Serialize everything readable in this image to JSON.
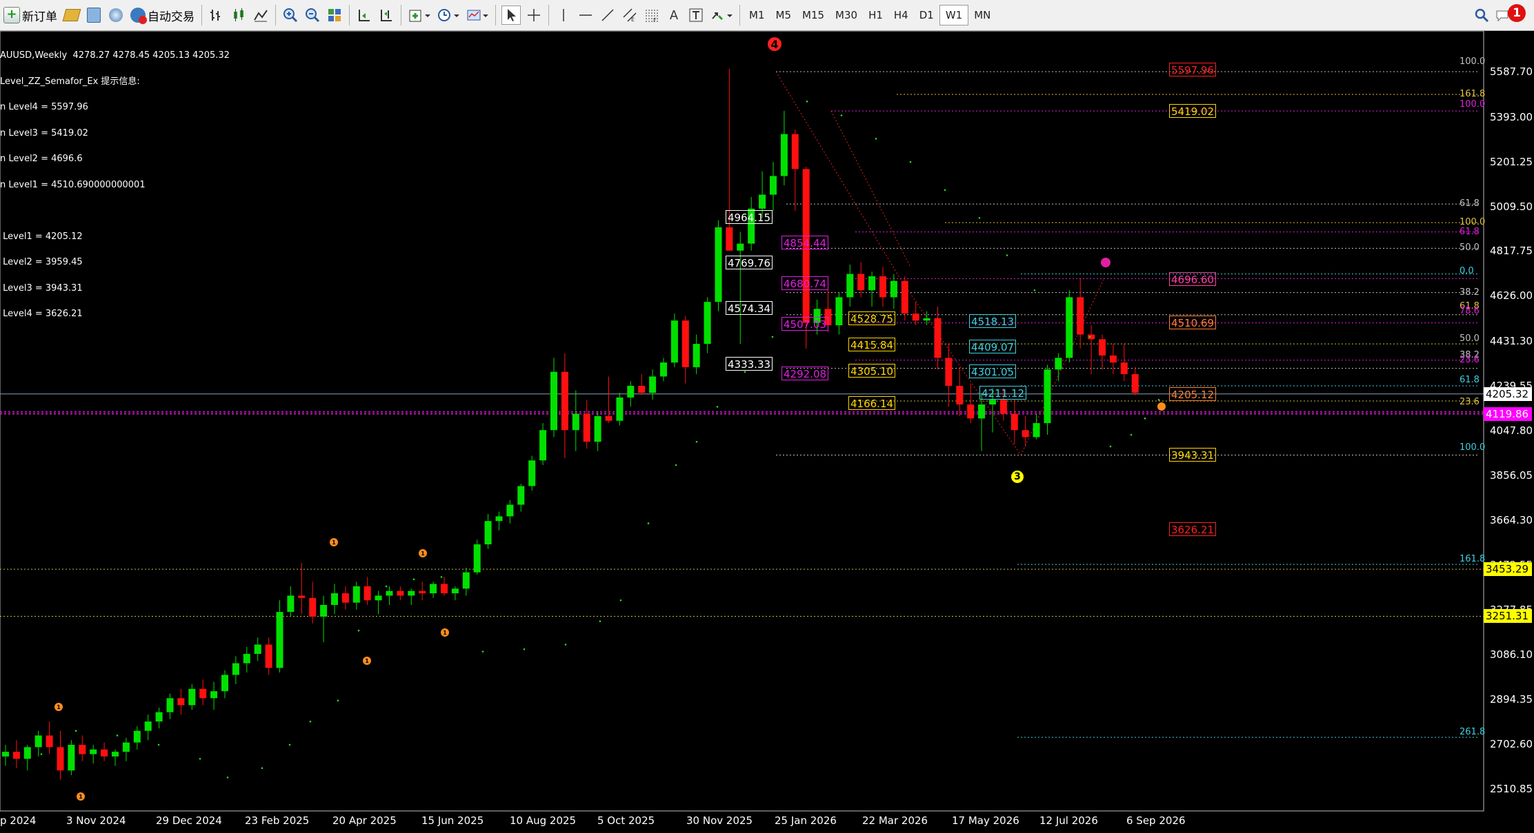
{
  "toolbar": {
    "new_order": "新订单",
    "auto_trade": "自动交易",
    "timeframes": [
      "M1",
      "M5",
      "M15",
      "M30",
      "H1",
      "H4",
      "D1",
      "W1",
      "MN"
    ],
    "active_timeframe": "W1",
    "alerts_count": "1",
    "text_tool": "A"
  },
  "info_panel": {
    "header": "AUUSD,Weekly  4278.27 4278.45 4205.13 4205.32",
    "indicator": "Level_ZZ_Semafor_Ex 提示信息:",
    "lines": [
      "n Level4 = 5597.96",
      "n Level3 = 5419.02",
      "n Level2 = 4696.6",
      "n Level1 = 4510.690000000001",
      "",
      " Level1 = 4205.12",
      " Level2 = 3959.45",
      " Level3 = 3943.31",
      " Level4 = 3626.21"
    ]
  },
  "price_axis": {
    "labels": [
      "5587.70",
      "5393.00",
      "5201.25",
      "5009.50",
      "4817.75",
      "4626.00",
      "4431.30",
      "4239.55",
      "4047.80",
      "3856.05",
      "3664.30",
      "3472.55",
      "3277.85",
      "3086.10",
      "2894.35",
      "2702.60",
      "2510.85"
    ],
    "current_price": "4205.32",
    "tag_magenta": "4119.86",
    "tag_yellow_1": "3453.29",
    "tag_yellow_2": "3251.31"
  },
  "time_axis": {
    "labels": [
      "p 2024",
      "3 Nov 2024",
      "29 Dec 2024",
      "23 Feb 2025",
      "20 Apr 2025",
      "15 Jun 2025",
      "10 Aug 2025",
      "5 Oct 2025",
      "30 Nov 2025",
      "25 Jan 2026",
      "22 Mar 2026",
      "17 May 2026",
      "12 Jul 2026",
      "6 Sep 2026"
    ]
  },
  "price_labels": [
    {
      "text": "5597.96",
      "color": "#ff2020"
    },
    {
      "text": "5419.02",
      "color": "#ffd700"
    },
    {
      "text": "4964.15",
      "color": "#ffffff"
    },
    {
      "text": "4769.76",
      "color": "#ffffff"
    },
    {
      "text": "4574.34",
      "color": "#ffffff"
    },
    {
      "text": "4333.33",
      "color": "#ffffff"
    },
    {
      "text": "4854.44",
      "color": "#e020e0"
    },
    {
      "text": "4680.74",
      "color": "#e020e0"
    },
    {
      "text": "4507.03",
      "color": "#e020e0"
    },
    {
      "text": "4292.08",
      "color": "#e020e0"
    },
    {
      "text": "4528.75",
      "color": "#ffd700"
    },
    {
      "text": "4415.84",
      "color": "#ffd700"
    },
    {
      "text": "4305.10",
      "color": "#ffd700"
    },
    {
      "text": "4166.14",
      "color": "#ffd700"
    },
    {
      "text": "4518.13",
      "color": "#40d0e0"
    },
    {
      "text": "4409.07",
      "color": "#40d0e0"
    },
    {
      "text": "4301.05",
      "color": "#40d0e0"
    },
    {
      "text": "4211.12",
      "color": "#40d0e0"
    },
    {
      "text": "4696.60",
      "color": "#ff40a0"
    },
    {
      "text": "4510.69",
      "color": "#ff8030"
    },
    {
      "text": "4205.12",
      "color": "#ff8030"
    },
    {
      "text": "3943.31",
      "color": "#ffd700"
    },
    {
      "text": "3626.21",
      "color": "#ff2020"
    }
  ],
  "fib_labels": [
    "100.0",
    "161.8",
    "100.0",
    "61.8",
    "100.0",
    "61.8",
    "50.0",
    "0.0",
    "38.2",
    "61.8",
    "78.6",
    "50.0",
    "38.2",
    "23.6",
    "61.8",
    "23.6",
    "100.0",
    "161.8",
    "261.8"
  ],
  "semafor_markers": [
    "4",
    "3",
    "1",
    "1",
    "1",
    "1",
    "1",
    "1"
  ],
  "chart_data": {
    "type": "candlestick",
    "symbol": "AUUSD",
    "timeframe": "Weekly",
    "ohlc_last": {
      "open": 4278.27,
      "high": 4278.45,
      "low": 4205.13,
      "close": 4205.32
    },
    "ylim": [
      2420,
      5720
    ],
    "candles": [
      [
        2650,
        2700,
        2610,
        2670
      ],
      [
        2670,
        2720,
        2600,
        2640
      ],
      [
        2640,
        2700,
        2590,
        2690
      ],
      [
        2690,
        2760,
        2650,
        2740
      ],
      [
        2740,
        2800,
        2660,
        2690
      ],
      [
        2690,
        2760,
        2550,
        2590
      ],
      [
        2590,
        2720,
        2570,
        2700
      ],
      [
        2700,
        2740,
        2630,
        2660
      ],
      [
        2660,
        2700,
        2620,
        2680
      ],
      [
        2680,
        2710,
        2630,
        2650
      ],
      [
        2650,
        2680,
        2610,
        2670
      ],
      [
        2670,
        2730,
        2630,
        2710
      ],
      [
        2710,
        2780,
        2680,
        2760
      ],
      [
        2760,
        2830,
        2720,
        2800
      ],
      [
        2800,
        2860,
        2770,
        2840
      ],
      [
        2840,
        2920,
        2810,
        2900
      ],
      [
        2900,
        2940,
        2830,
        2870
      ],
      [
        2870,
        2960,
        2850,
        2940
      ],
      [
        2940,
        2980,
        2870,
        2900
      ],
      [
        2900,
        2970,
        2850,
        2930
      ],
      [
        2930,
        3020,
        2900,
        3000
      ],
      [
        3000,
        3080,
        2960,
        3050
      ],
      [
        3050,
        3120,
        3010,
        3090
      ],
      [
        3090,
        3160,
        3060,
        3130
      ],
      [
        3130,
        3160,
        3000,
        3030
      ],
      [
        3030,
        3320,
        3010,
        3270
      ],
      [
        3270,
        3380,
        3250,
        3340
      ],
      [
        3340,
        3480,
        3260,
        3330
      ],
      [
        3330,
        3400,
        3220,
        3250
      ],
      [
        3250,
        3340,
        3140,
        3300
      ],
      [
        3300,
        3390,
        3260,
        3350
      ],
      [
        3350,
        3380,
        3280,
        3310
      ],
      [
        3310,
        3400,
        3280,
        3380
      ],
      [
        3380,
        3420,
        3300,
        3320
      ],
      [
        3320,
        3360,
        3260,
        3340
      ],
      [
        3340,
        3380,
        3300,
        3360
      ],
      [
        3360,
        3380,
        3320,
        3340
      ],
      [
        3340,
        3370,
        3300,
        3360
      ],
      [
        3360,
        3400,
        3320,
        3350
      ],
      [
        3350,
        3400,
        3330,
        3390
      ],
      [
        3390,
        3420,
        3340,
        3350
      ],
      [
        3350,
        3380,
        3320,
        3370
      ],
      [
        3370,
        3460,
        3340,
        3440
      ],
      [
        3440,
        3580,
        3430,
        3560
      ],
      [
        3560,
        3690,
        3540,
        3660
      ],
      [
        3660,
        3700,
        3620,
        3680
      ],
      [
        3680,
        3750,
        3650,
        3730
      ],
      [
        3730,
        3820,
        3700,
        3810
      ],
      [
        3810,
        3940,
        3790,
        3920
      ],
      [
        3920,
        4080,
        3900,
        4050
      ],
      [
        4050,
        4360,
        4020,
        4300
      ],
      [
        4300,
        4380,
        3930,
        4050
      ],
      [
        4050,
        4220,
        3960,
        4120
      ],
      [
        4120,
        4180,
        3970,
        4000
      ],
      [
        4000,
        4130,
        3960,
        4110
      ],
      [
        4110,
        4280,
        4080,
        4090
      ],
      [
        4090,
        4210,
        4070,
        4190
      ],
      [
        4190,
        4260,
        4150,
        4240
      ],
      [
        4240,
        4290,
        4200,
        4210
      ],
      [
        4210,
        4310,
        4180,
        4280
      ],
      [
        4280,
        4360,
        4260,
        4340
      ],
      [
        4340,
        4550,
        4320,
        4520
      ],
      [
        4520,
        4540,
        4250,
        4320
      ],
      [
        4320,
        4460,
        4290,
        4420
      ],
      [
        4420,
        4620,
        4380,
        4600
      ],
      [
        4600,
        4950,
        4560,
        4920
      ],
      [
        4920,
        5600,
        4900,
        4820
      ],
      [
        4820,
        4900,
        4420,
        4850
      ],
      [
        4850,
        5050,
        4820,
        5000
      ],
      [
        5000,
        5160,
        4960,
        5060
      ],
      [
        5060,
        5200,
        4990,
        5140
      ],
      [
        5140,
        5420,
        5100,
        5320
      ],
      [
        5320,
        5340,
        4990,
        5170
      ],
      [
        5170,
        5180,
        4400,
        4510
      ],
      [
        4510,
        4610,
        4460,
        4570
      ],
      [
        4570,
        4680,
        4470,
        4500
      ],
      [
        4500,
        4640,
        4460,
        4620
      ],
      [
        4620,
        4760,
        4580,
        4720
      ],
      [
        4720,
        4770,
        4620,
        4650
      ],
      [
        4650,
        4730,
        4580,
        4710
      ],
      [
        4710,
        4750,
        4580,
        4620
      ],
      [
        4620,
        4720,
        4570,
        4690
      ],
      [
        4690,
        4710,
        4520,
        4550
      ],
      [
        4550,
        4600,
        4500,
        4520
      ],
      [
        4520,
        4560,
        4500,
        4530
      ],
      [
        4530,
        4580,
        4310,
        4360
      ],
      [
        4360,
        4420,
        4150,
        4240
      ],
      [
        4240,
        4320,
        4110,
        4160
      ],
      [
        4160,
        4250,
        4080,
        4100
      ],
      [
        4100,
        4210,
        3960,
        4160
      ],
      [
        4160,
        4230,
        4040,
        4180
      ],
      [
        4180,
        4230,
        4090,
        4120
      ],
      [
        4120,
        4180,
        3990,
        4050
      ],
      [
        4050,
        4110,
        3980,
        4020
      ],
      [
        4020,
        4120,
        4010,
        4080
      ],
      [
        4080,
        4330,
        4030,
        4310
      ],
      [
        4310,
        4380,
        4260,
        4360
      ],
      [
        4360,
        4650,
        4340,
        4620
      ],
      [
        4620,
        4700,
        4400,
        4460
      ],
      [
        4460,
        4500,
        4290,
        4440
      ],
      [
        4440,
        4460,
        4310,
        4370
      ],
      [
        4370,
        4420,
        4290,
        4340
      ],
      [
        4340,
        4420,
        4260,
        4290
      ],
      [
        4290,
        4320,
        4200,
        4210
      ]
    ],
    "horizontal_lines": {
      "current_price": 4205.32,
      "magenta_levels": [
        4119.86,
        4128
      ],
      "yellow_levels": [
        3453.29,
        3251.31
      ]
    }
  }
}
